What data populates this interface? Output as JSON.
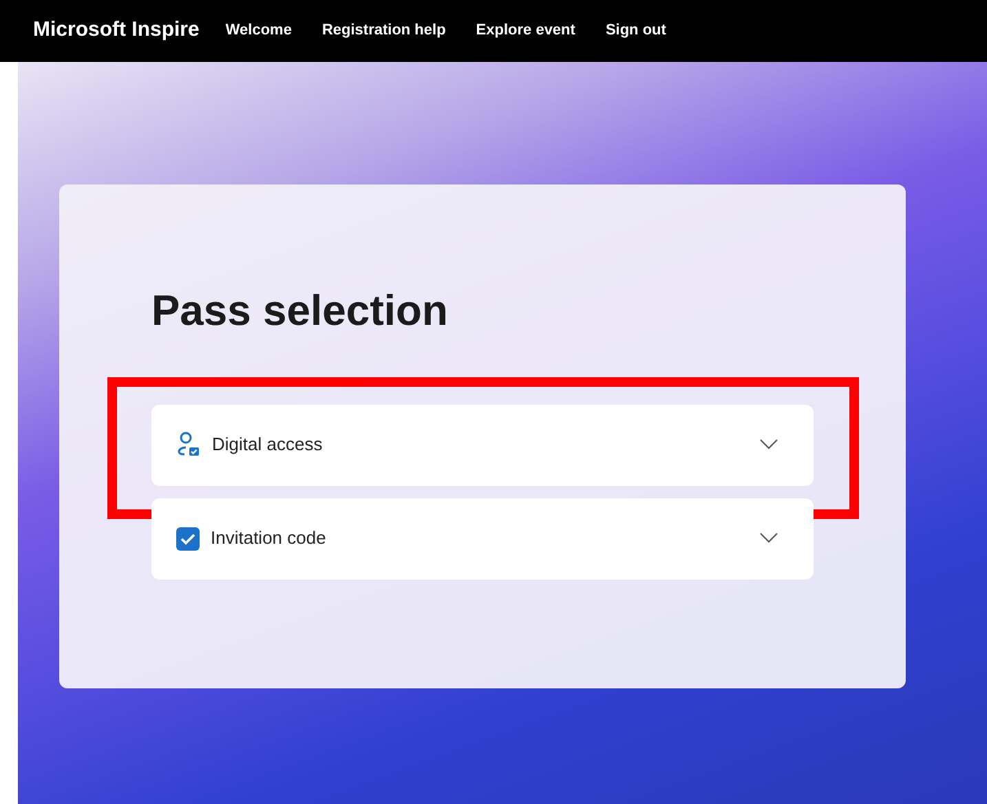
{
  "nav": {
    "brand": "Microsoft Inspire",
    "links": [
      "Welcome",
      "Registration help",
      "Explore event",
      "Sign out"
    ]
  },
  "page": {
    "title": "Pass selection",
    "options": [
      {
        "kind": "person",
        "label": "Digital access",
        "highlighted": true
      },
      {
        "kind": "checkbox",
        "label": "Invitation code",
        "checked": true,
        "highlighted": false
      }
    ]
  }
}
